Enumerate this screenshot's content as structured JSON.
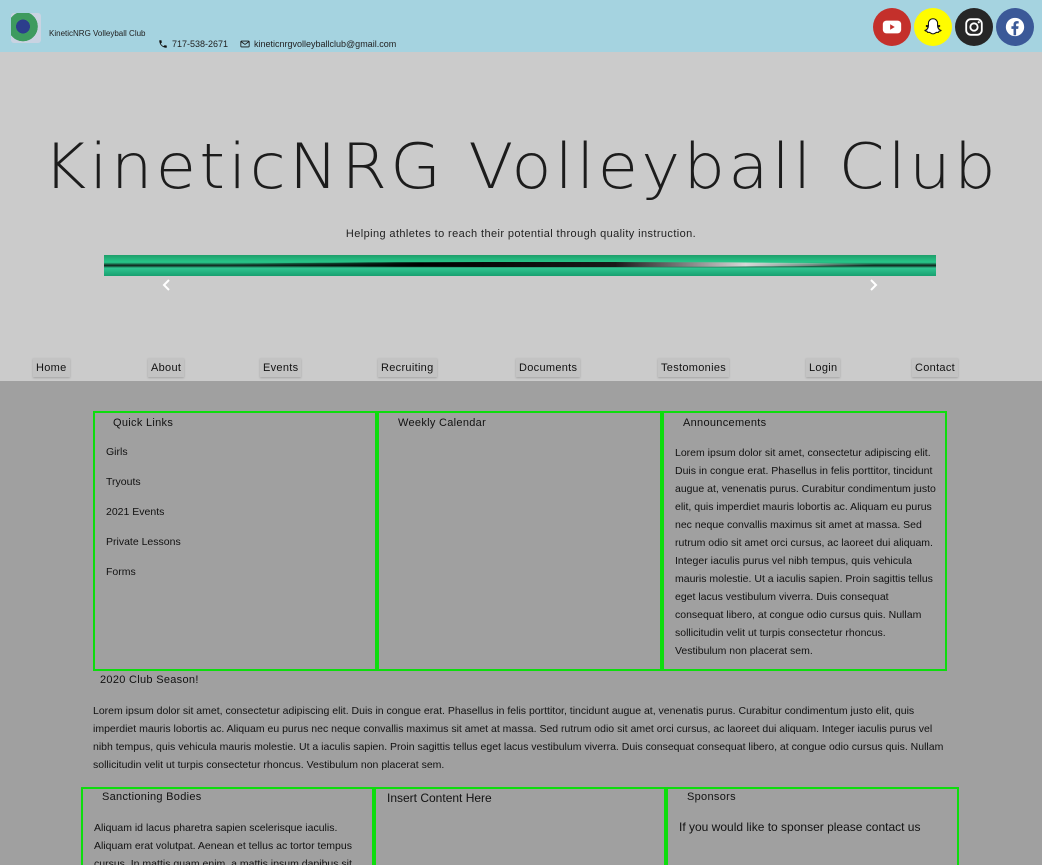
{
  "header": {
    "site_name": "KineticNRG Volleyball Club",
    "phone": "717-538-2671",
    "email": "kineticnrgvolleyballclub@gmail.com",
    "social_icons": [
      "youtube-icon",
      "snapchat-icon",
      "instagram-icon",
      "facebook-icon"
    ],
    "social_colors": {
      "youtube": "#c4302b",
      "snapchat": "#fffc00",
      "instagram": "#262626",
      "facebook": "#3b5998"
    }
  },
  "hero": {
    "title": "KineticNRG Volleyball Club",
    "subtitle": "Helping athletes to reach their potential through quality instruction.",
    "prev_label": "Previous",
    "next_label": "Next"
  },
  "nav": {
    "items": [
      "Home",
      "About",
      "Events",
      "Recruiting",
      "Documents",
      "Testomonies",
      "Login",
      "Contact"
    ]
  },
  "quick_links": {
    "title": "Quick Links",
    "items": [
      "Girls",
      "Tryouts",
      "2021 Events",
      "Private Lessons",
      "Forms"
    ]
  },
  "calendar": {
    "title": "Weekly Calendar"
  },
  "announcements": {
    "title": "Announcements",
    "text": "Lorem ipsum dolor sit amet, consectetur adipiscing elit. Duis in congue erat. Phasellus in felis porttitor, tincidunt augue at, venenatis purus. Curabitur condimentum justo elit, quis imperdiet mauris lobortis ac. Aliquam eu purus nec neque convallis maximus sit amet at massa. Sed rutrum odio sit amet orci cursus, ac laoreet dui aliquam. Integer iaculis purus vel nibh tempus, quis vehicula mauris molestie. Ut a iaculis sapien. Proin sagittis tellus eget lacus vestibulum viverra. Duis consequat consequat libero, at congue odio cursus quis. Nullam sollicitudin velit ut turpis consectetur rhoncus. Vestibulum non placerat sem."
  },
  "season": {
    "title": "2020 Club Season!",
    "text": "Lorem ipsum dolor sit amet, consectetur adipiscing elit. Duis in congue erat. Phasellus in felis porttitor, tincidunt augue at, venenatis purus. Curabitur condimentum justo elit, quis imperdiet mauris lobortis ac. Aliquam eu purus nec neque convallis maximus sit amet at massa. Sed rutrum odio sit amet orci cursus, ac laoreet dui aliquam. Integer iaculis purus vel nibh tempus, quis vehicula mauris molestie. Ut a iaculis sapien. Proin sagittis tellus eget lacus vestibulum viverra. Duis consequat consequat libero, at congue odio cursus quis. Nullam sollicitudin velit ut turpis consectetur rhoncus. Vestibulum non placerat sem."
  },
  "sanctioning": {
    "title": "Sanctioning Bodies",
    "text": "Aliquam id lacus pharetra sapien scelerisque iaculis. Aliquam erat volutpat. Aenean et tellus ac tortor tempus cursus. In mattis quam enim, a mattis ipsum dapibus sit"
  },
  "insert": {
    "text": "Insert Content Here"
  },
  "sponsors": {
    "title": "Sponsors",
    "text": "If you would like to sponser please contact us"
  },
  "colors": {
    "topbar": "#a5d3e0",
    "hero_bg": "#cbcbcb",
    "page_bg": "#a0a0a0",
    "panel_border": "#0ddd0d"
  }
}
